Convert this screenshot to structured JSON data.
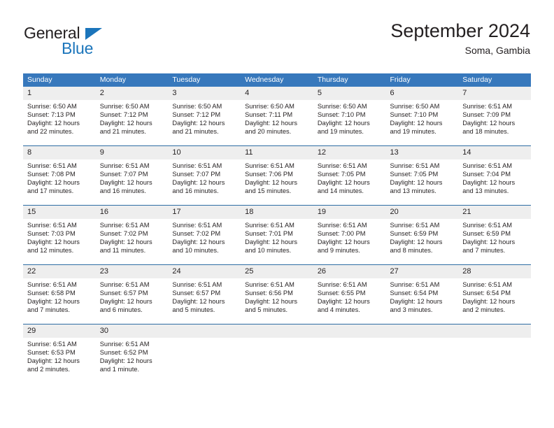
{
  "brand": {
    "name_part1": "General",
    "name_part2": "Blue",
    "accent_color": "#1b75bb",
    "triangle_icon": "logo-triangle-icon"
  },
  "header": {
    "title": "September 2024",
    "subtitle": "Soma, Gambia"
  },
  "theme": {
    "header_row_bg": "#3778bc",
    "header_row_text": "#ffffff",
    "daynum_bg": "#eeeeee",
    "row_divider": "#2e6da4",
    "body_text": "#231f20"
  },
  "weekdays": [
    "Sunday",
    "Monday",
    "Tuesday",
    "Wednesday",
    "Thursday",
    "Friday",
    "Saturday"
  ],
  "weeks": [
    [
      {
        "day": "1",
        "sunrise": "Sunrise: 6:50 AM",
        "sunset": "Sunset: 7:13 PM",
        "daylight1": "Daylight: 12 hours",
        "daylight2": "and 22 minutes."
      },
      {
        "day": "2",
        "sunrise": "Sunrise: 6:50 AM",
        "sunset": "Sunset: 7:12 PM",
        "daylight1": "Daylight: 12 hours",
        "daylight2": "and 21 minutes."
      },
      {
        "day": "3",
        "sunrise": "Sunrise: 6:50 AM",
        "sunset": "Sunset: 7:12 PM",
        "daylight1": "Daylight: 12 hours",
        "daylight2": "and 21 minutes."
      },
      {
        "day": "4",
        "sunrise": "Sunrise: 6:50 AM",
        "sunset": "Sunset: 7:11 PM",
        "daylight1": "Daylight: 12 hours",
        "daylight2": "and 20 minutes."
      },
      {
        "day": "5",
        "sunrise": "Sunrise: 6:50 AM",
        "sunset": "Sunset: 7:10 PM",
        "daylight1": "Daylight: 12 hours",
        "daylight2": "and 19 minutes."
      },
      {
        "day": "6",
        "sunrise": "Sunrise: 6:50 AM",
        "sunset": "Sunset: 7:10 PM",
        "daylight1": "Daylight: 12 hours",
        "daylight2": "and 19 minutes."
      },
      {
        "day": "7",
        "sunrise": "Sunrise: 6:51 AM",
        "sunset": "Sunset: 7:09 PM",
        "daylight1": "Daylight: 12 hours",
        "daylight2": "and 18 minutes."
      }
    ],
    [
      {
        "day": "8",
        "sunrise": "Sunrise: 6:51 AM",
        "sunset": "Sunset: 7:08 PM",
        "daylight1": "Daylight: 12 hours",
        "daylight2": "and 17 minutes."
      },
      {
        "day": "9",
        "sunrise": "Sunrise: 6:51 AM",
        "sunset": "Sunset: 7:07 PM",
        "daylight1": "Daylight: 12 hours",
        "daylight2": "and 16 minutes."
      },
      {
        "day": "10",
        "sunrise": "Sunrise: 6:51 AM",
        "sunset": "Sunset: 7:07 PM",
        "daylight1": "Daylight: 12 hours",
        "daylight2": "and 16 minutes."
      },
      {
        "day": "11",
        "sunrise": "Sunrise: 6:51 AM",
        "sunset": "Sunset: 7:06 PM",
        "daylight1": "Daylight: 12 hours",
        "daylight2": "and 15 minutes."
      },
      {
        "day": "12",
        "sunrise": "Sunrise: 6:51 AM",
        "sunset": "Sunset: 7:05 PM",
        "daylight1": "Daylight: 12 hours",
        "daylight2": "and 14 minutes."
      },
      {
        "day": "13",
        "sunrise": "Sunrise: 6:51 AM",
        "sunset": "Sunset: 7:05 PM",
        "daylight1": "Daylight: 12 hours",
        "daylight2": "and 13 minutes."
      },
      {
        "day": "14",
        "sunrise": "Sunrise: 6:51 AM",
        "sunset": "Sunset: 7:04 PM",
        "daylight1": "Daylight: 12 hours",
        "daylight2": "and 13 minutes."
      }
    ],
    [
      {
        "day": "15",
        "sunrise": "Sunrise: 6:51 AM",
        "sunset": "Sunset: 7:03 PM",
        "daylight1": "Daylight: 12 hours",
        "daylight2": "and 12 minutes."
      },
      {
        "day": "16",
        "sunrise": "Sunrise: 6:51 AM",
        "sunset": "Sunset: 7:02 PM",
        "daylight1": "Daylight: 12 hours",
        "daylight2": "and 11 minutes."
      },
      {
        "day": "17",
        "sunrise": "Sunrise: 6:51 AM",
        "sunset": "Sunset: 7:02 PM",
        "daylight1": "Daylight: 12 hours",
        "daylight2": "and 10 minutes."
      },
      {
        "day": "18",
        "sunrise": "Sunrise: 6:51 AM",
        "sunset": "Sunset: 7:01 PM",
        "daylight1": "Daylight: 12 hours",
        "daylight2": "and 10 minutes."
      },
      {
        "day": "19",
        "sunrise": "Sunrise: 6:51 AM",
        "sunset": "Sunset: 7:00 PM",
        "daylight1": "Daylight: 12 hours",
        "daylight2": "and 9 minutes."
      },
      {
        "day": "20",
        "sunrise": "Sunrise: 6:51 AM",
        "sunset": "Sunset: 6:59 PM",
        "daylight1": "Daylight: 12 hours",
        "daylight2": "and 8 minutes."
      },
      {
        "day": "21",
        "sunrise": "Sunrise: 6:51 AM",
        "sunset": "Sunset: 6:59 PM",
        "daylight1": "Daylight: 12 hours",
        "daylight2": "and 7 minutes."
      }
    ],
    [
      {
        "day": "22",
        "sunrise": "Sunrise: 6:51 AM",
        "sunset": "Sunset: 6:58 PM",
        "daylight1": "Daylight: 12 hours",
        "daylight2": "and 7 minutes."
      },
      {
        "day": "23",
        "sunrise": "Sunrise: 6:51 AM",
        "sunset": "Sunset: 6:57 PM",
        "daylight1": "Daylight: 12 hours",
        "daylight2": "and 6 minutes."
      },
      {
        "day": "24",
        "sunrise": "Sunrise: 6:51 AM",
        "sunset": "Sunset: 6:57 PM",
        "daylight1": "Daylight: 12 hours",
        "daylight2": "and 5 minutes."
      },
      {
        "day": "25",
        "sunrise": "Sunrise: 6:51 AM",
        "sunset": "Sunset: 6:56 PM",
        "daylight1": "Daylight: 12 hours",
        "daylight2": "and 5 minutes."
      },
      {
        "day": "26",
        "sunrise": "Sunrise: 6:51 AM",
        "sunset": "Sunset: 6:55 PM",
        "daylight1": "Daylight: 12 hours",
        "daylight2": "and 4 minutes."
      },
      {
        "day": "27",
        "sunrise": "Sunrise: 6:51 AM",
        "sunset": "Sunset: 6:54 PM",
        "daylight1": "Daylight: 12 hours",
        "daylight2": "and 3 minutes."
      },
      {
        "day": "28",
        "sunrise": "Sunrise: 6:51 AM",
        "sunset": "Sunset: 6:54 PM",
        "daylight1": "Daylight: 12 hours",
        "daylight2": "and 2 minutes."
      }
    ],
    [
      {
        "day": "29",
        "sunrise": "Sunrise: 6:51 AM",
        "sunset": "Sunset: 6:53 PM",
        "daylight1": "Daylight: 12 hours",
        "daylight2": "and 2 minutes."
      },
      {
        "day": "30",
        "sunrise": "Sunrise: 6:51 AM",
        "sunset": "Sunset: 6:52 PM",
        "daylight1": "Daylight: 12 hours",
        "daylight2": "and 1 minute."
      },
      {
        "day": "",
        "sunrise": "",
        "sunset": "",
        "daylight1": "",
        "daylight2": ""
      },
      {
        "day": "",
        "sunrise": "",
        "sunset": "",
        "daylight1": "",
        "daylight2": ""
      },
      {
        "day": "",
        "sunrise": "",
        "sunset": "",
        "daylight1": "",
        "daylight2": ""
      },
      {
        "day": "",
        "sunrise": "",
        "sunset": "",
        "daylight1": "",
        "daylight2": ""
      },
      {
        "day": "",
        "sunrise": "",
        "sunset": "",
        "daylight1": "",
        "daylight2": ""
      }
    ]
  ]
}
